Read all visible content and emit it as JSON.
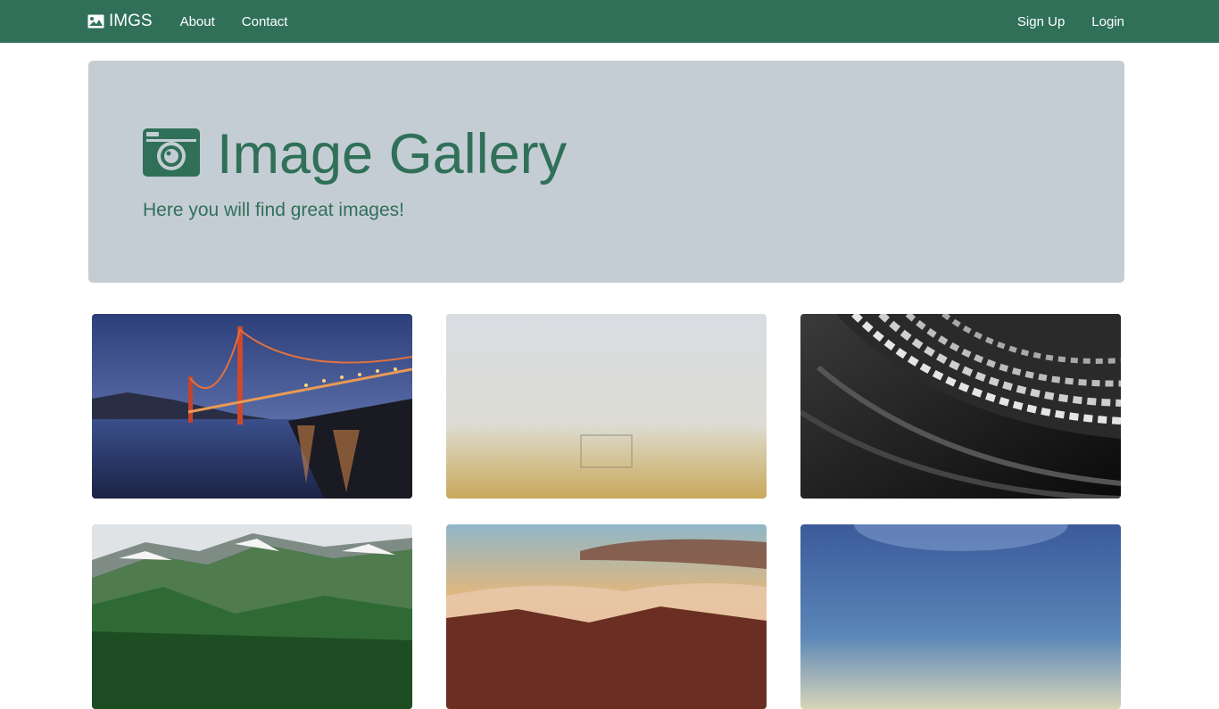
{
  "navbar": {
    "brand": "IMGS",
    "links": [
      "About",
      "Contact"
    ],
    "auth": [
      "Sign Up",
      "Login"
    ],
    "color": "#307059"
  },
  "hero": {
    "title": "Image Gallery",
    "subtitle": "Here you will find great images!",
    "icon": "camera-icon",
    "background": "#c5cdd4"
  },
  "gallery": {
    "images": [
      "golden-gate-bridge-at-dusk",
      "foggy-field-with-goal",
      "black-white-architecture",
      "green-mountains-with-snow",
      "sunset-clouds-over-mountains",
      "blue-sky-horizon"
    ]
  }
}
